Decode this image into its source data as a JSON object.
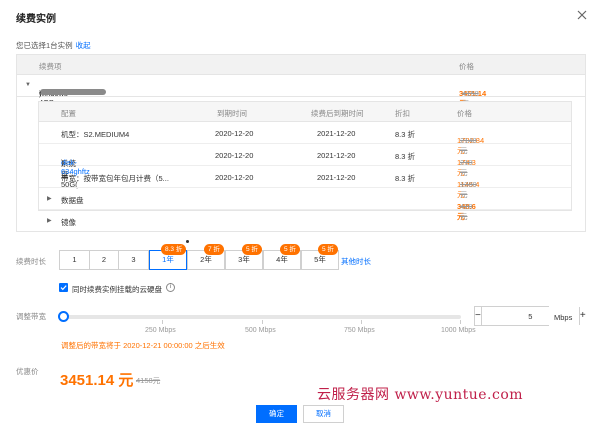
{
  "dialog": {
    "title": "续费实例"
  },
  "selected": {
    "text": "您已选择1台实例",
    "collapse_link": "收起"
  },
  "outer_table": {
    "headers": {
      "item": "续费项",
      "price": "价格"
    },
    "instance": {
      "name_prefix": "windows-4GB-",
      "name_suffix": ")",
      "price": "3451.14 元",
      "original": "4158元"
    },
    "data_disk": {
      "label": "数据盘",
      "price": "348.6 元",
      "original": "420元"
    },
    "image": {
      "label": "镜像"
    }
  },
  "inner_table": {
    "headers": {
      "config": "配置",
      "expire": "到期时间",
      "renew_expire": "续费后到期时间",
      "discount": "折扣",
      "price": "价格"
    },
    "rows": [
      {
        "config": "机型：S2.MEDIUM4",
        "config_link": "",
        "config_tail": "",
        "expire": "2020-12-20",
        "renew_expire": "2021-12-20",
        "discount": "8.3 折",
        "price": "1782.84 元",
        "original": "2148元"
      },
      {
        "config": "系统盘：50G(",
        "config_link": "disk-634ghftz",
        "config_tail": ")",
        "expire": "2020-12-20",
        "renew_expire": "2021-12-20",
        "discount": "8.3 折",
        "price": "174.3 元",
        "original": "210元"
      },
      {
        "config": "带宽：按带宽包年包月计费（5...",
        "config_link": "",
        "config_tail": "",
        "expire": "2020-12-20",
        "renew_expire": "2021-12-20",
        "discount": "8.3 折",
        "price": "1145.4 元",
        "original": "1380元"
      }
    ]
  },
  "duration": {
    "label": "续费时长",
    "options": [
      "1",
      "2",
      "3",
      "1年",
      "2年",
      "3年",
      "4年",
      "5年"
    ],
    "selected": "1年",
    "badges": [
      "8.3 折",
      "7 折",
      "5 折",
      "5 折",
      "5 折"
    ],
    "more_link": "其他时长"
  },
  "disk_checkbox": {
    "label": "同时续费实例挂载的云硬盘",
    "checked": true
  },
  "bandwidth": {
    "label": "调整带宽",
    "ticks": [
      "250 Mbps",
      "500 Mbps",
      "750 Mbps",
      "1000 Mbps"
    ],
    "value": "5",
    "max": 1000,
    "unit": "Mbps",
    "note": "调整后的带宽将于 2020-12-21 00:00:00 之后生效"
  },
  "total": {
    "label": "优惠价",
    "price": "3451.14 元",
    "original": "4158元"
  },
  "watermark": "云服务器网 www.yuntue.com",
  "buttons": {
    "confirm": "确定",
    "cancel": "取消"
  },
  "colors": {
    "accent": "#006eff",
    "price": "#ff7200",
    "watermark": "#c0204a"
  },
  "icons": {
    "close": "close-icon",
    "caret_down": "caret-down-icon",
    "caret_right": "caret-right-icon",
    "info": "info-icon",
    "check": "check-icon"
  }
}
